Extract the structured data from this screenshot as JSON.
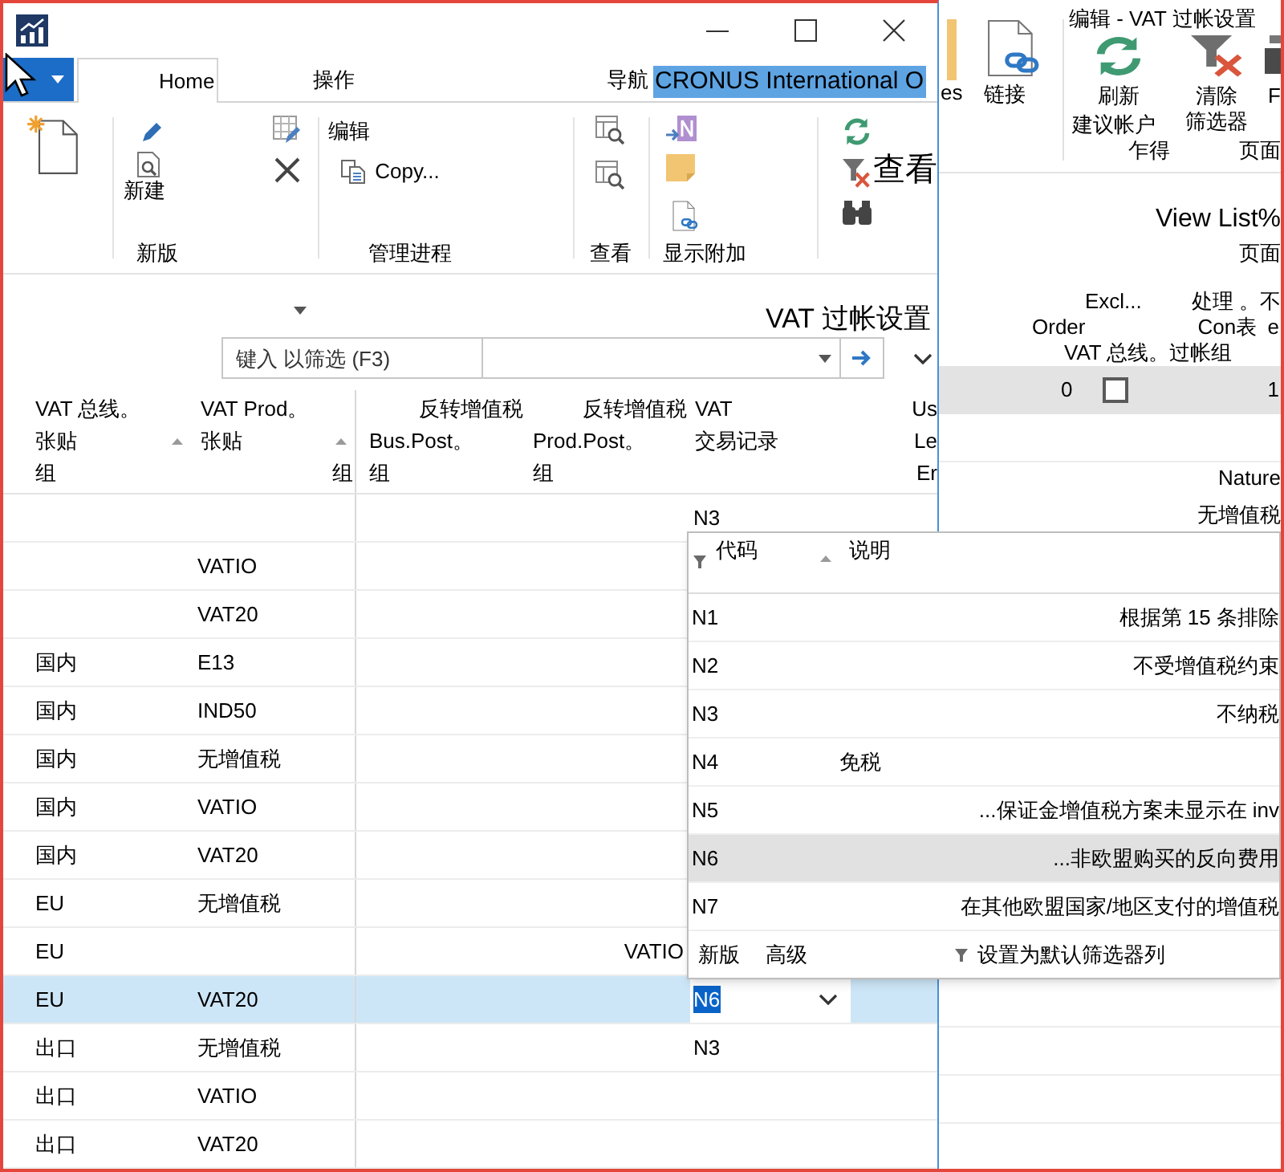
{
  "window": {
    "tabs": [
      {
        "label": "Home",
        "selected": true
      },
      {
        "label": "操作",
        "selected": false
      },
      {
        "label": "导航",
        "selected": false
      }
    ],
    "company": {
      "label": "CRONUS International O",
      "selected": true
    }
  },
  "ribbon": {
    "groups": [
      {
        "kind": "new_document"
      },
      {
        "kind": "new",
        "label": "新版",
        "action": "新建"
      },
      {
        "kind": "manage",
        "label": "管理进程",
        "actions": [
          "编辑",
          "Copy..."
        ]
      },
      {
        "kind": "view",
        "label": "查看"
      },
      {
        "kind": "attachments",
        "label": "显示附加"
      },
      {
        "kind": "page",
        "label": "查看"
      }
    ]
  },
  "page_title": "VAT 过帐设置",
  "filter": {
    "placeholder": "键入 以筛选 (F3)"
  },
  "table": {
    "columns": [
      {
        "lines": [
          "VAT 总线。",
          "张贴",
          "组"
        ],
        "sorted": true
      },
      {
        "lines": [
          "VAT Prod。",
          "张贴",
          "组"
        ],
        "sorted": true
      },
      {
        "lines": [
          "反转增值税",
          "Bus.Post。",
          "组"
        ],
        "sorted": false
      },
      {
        "lines": [
          "反转增值税",
          "Prod.Post。",
          "组"
        ],
        "sorted": false
      },
      {
        "lines": [
          "VAT",
          "交易记录"
        ],
        "sorted": false
      },
      {
        "lines": [
          "Us",
          "Le",
          "Er"
        ],
        "sorted": false
      }
    ],
    "rows": [
      {
        "selected": false,
        "editing": false,
        "vat_transaction": "N3"
      },
      {
        "selected": false,
        "editing": false,
        "prod_group": "VATIO"
      },
      {
        "selected": false,
        "editing": false,
        "prod_group": "VAT20"
      },
      {
        "selected": false,
        "editing": false,
        "bus_group": "国内",
        "prod_group": "E13"
      },
      {
        "selected": false,
        "editing": false,
        "bus_group": "国内",
        "prod_group": "IND50"
      },
      {
        "selected": false,
        "editing": false,
        "bus_group": "国内",
        "prod_group": "无增值税"
      },
      {
        "selected": false,
        "editing": false,
        "bus_group": "国内",
        "prod_group": "VATIO"
      },
      {
        "selected": false,
        "editing": false,
        "bus_group": "国内",
        "prod_group": "VAT20"
      },
      {
        "selected": false,
        "editing": false,
        "bus_group": "EU",
        "prod_group": "无增值税"
      },
      {
        "selected": false,
        "editing": false,
        "bus_group": "EU",
        "reverse_prod_group": "VATIO"
      },
      {
        "selected": true,
        "editing": true,
        "bus_group": "EU",
        "prod_group": "VAT20",
        "vat_transaction": "N6"
      },
      {
        "selected": false,
        "editing": false,
        "bus_group": "出口",
        "prod_group": "无增值税",
        "vat_transaction": "N3"
      },
      {
        "selected": false,
        "editing": false,
        "bus_group": "出口",
        "prod_group": "VATIO"
      },
      {
        "selected": false,
        "editing": false,
        "bus_group": "出口",
        "prod_group": "VAT20"
      }
    ]
  },
  "lookup": {
    "header": {
      "filtered": true,
      "columns": [
        {
          "label": "代码",
          "sorted": true
        },
        {
          "label": "说明",
          "sorted": false
        }
      ]
    },
    "rows": [
      {
        "code": "N1",
        "description": "根据第 15 条排除",
        "selected": false
      },
      {
        "code": "N2",
        "description": "不受增值税约束",
        "selected": false
      },
      {
        "code": "N3",
        "description": "不纳税",
        "selected": false
      },
      {
        "code": "N4",
        "description": "免税",
        "selected": false
      },
      {
        "code": "N5",
        "description": "...保证金增值税方案未显示在 inv",
        "selected": false
      },
      {
        "code": "N6",
        "description": "...非欧盟购买的反向费用",
        "selected": true
      },
      {
        "code": "N7",
        "description": "在其他欧盟国家/地区支付的增值税",
        "selected": false
      }
    ],
    "footer": {
      "actions": [
        "新版",
        "高级"
      ],
      "default_filter": "设置为默认筛选器列"
    }
  },
  "background_window": {
    "ribbon": {
      "fragment": "es",
      "link": "链接",
      "title": "编辑 - VAT 过帐设置",
      "refresh": "刷新",
      "clear_filter": [
        "清除",
        "筛选器"
      ],
      "cut_action": "F",
      "suggest_account": "建议帐户",
      "fragment_2": "乍得",
      "group_label": "页面"
    },
    "page_heading": "View List%",
    "page_label": "页面",
    "grid": {
      "header_row_1": [
        "Excl...",
        "处理 。不"
      ],
      "header_row_2": [
        "Order",
        "Con表",
        "e"
      ],
      "group_header": "VAT 总线。过帐组",
      "record": {
        "selected": true,
        "order": "0",
        "checked": false,
        "last": "1"
      },
      "nature_header": "Nature",
      "nature_value": "无增值税"
    }
  }
}
